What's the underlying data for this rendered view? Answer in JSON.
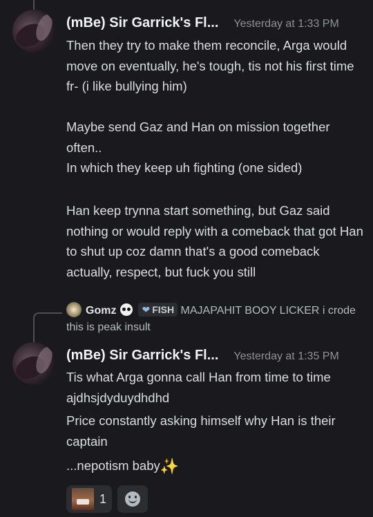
{
  "messages": [
    {
      "username": "(mBe) Sir Garrick's Fl...",
      "timestamp": "Yesterday at 1:33 PM",
      "paragraphs": [
        "Then they try to make them reconcile, Arga would move on eventually, he's tough, tis not his first time fr- (i like bullying him)",
        "Maybe send Gaz and Han on mission together often..\nIn which they keep uh fighting (one sided)",
        "Han keep trynna start something, but Gaz said nothing or would reply with a comeback that got Han to shut up coz damn that's a good comeback actually, respect, but fuck you still"
      ]
    },
    {
      "username": "(mBe) Sir Garrick's Fl...",
      "timestamp": "Yesterday at 1:35 PM",
      "reply": {
        "name": "Gomz",
        "tag": "FISH",
        "tag_icon": "heart-icon",
        "text": "MAJAPAHIT BOOY LICKER i crode this is peak insult"
      },
      "paragraphs": [
        "Tis what Arga gonna call Han from time to time ajdhsjdyduydhdhd",
        "Price constantly asking himself why Han is their captain",
        "...nepotism baby"
      ],
      "emoji": "sparkles-icon",
      "reactions": [
        {
          "emoji": "custom-face-emoji",
          "count": "1"
        }
      ],
      "add_reaction_icon": "smiley-add-reaction-icon"
    }
  ],
  "colors": {
    "background": "#1a1a1e",
    "text": "#dbdee1",
    "username": "#f2f3f5",
    "timestamp": "#8e9297"
  }
}
